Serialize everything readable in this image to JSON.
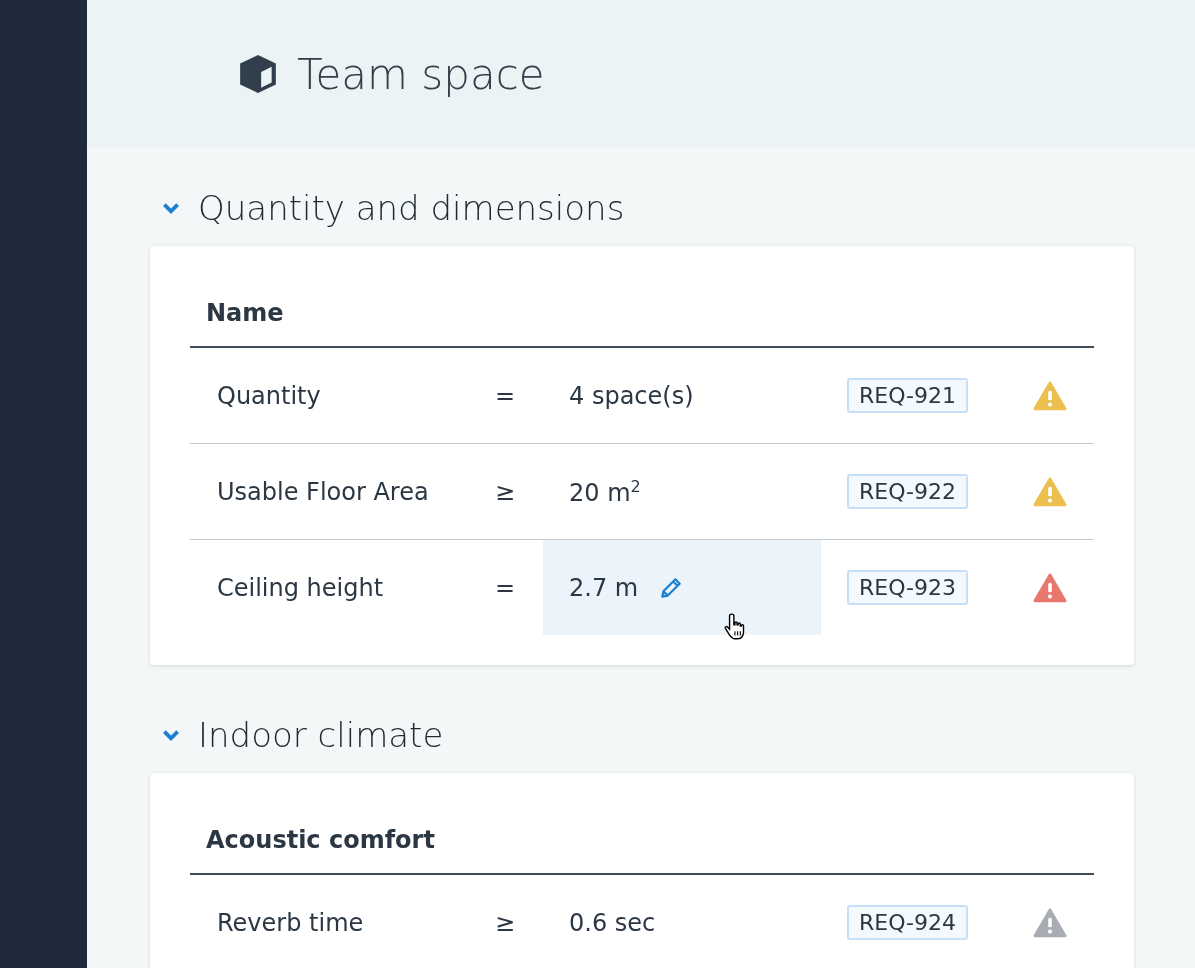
{
  "header": {
    "title": "Team space"
  },
  "sections": [
    {
      "title": "Quantity and dimensions",
      "expanded": true,
      "heading": "Name",
      "rows": [
        {
          "name": "Quantity",
          "operator": "=",
          "value": "4 space(s)",
          "reference": "REQ-921",
          "color": "#ecc04f",
          "highlighted": false
        },
        {
          "name": "Usable Floor Area",
          "operator": "≥",
          "value": "20 m$^{2}$",
          "reference": "REQ-922",
          "color": "#ecc04f",
          "highlighted": false
        },
        {
          "name": "Ceiling height",
          "operator": "=",
          "value": "2.7 m",
          "reference": "REQ-923",
          "color": "#e8786d",
          "highlighted": true
        }
      ]
    },
    {
      "title": "Indoor climate",
      "expanded": true,
      "heading": "Acoustic comfort",
      "rows": [
        {
          "name": "Reverb time",
          "operator": "≥",
          "value": "0.6 sec",
          "reference": "REQ-924",
          "color": "#a9adb3",
          "highlighted": false
        }
      ]
    }
  ]
}
